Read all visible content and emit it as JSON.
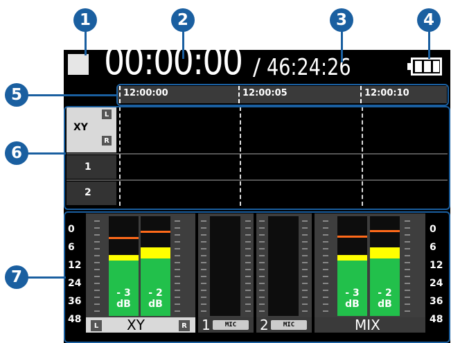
{
  "callouts": [
    "1",
    "2",
    "3",
    "4",
    "5",
    "6",
    "7"
  ],
  "header": {
    "elapsed_time": "00:00:00",
    "separator": "/",
    "remaining_time": "46:24:26",
    "status_icon": "stop-square-icon",
    "battery_icon": "battery-icon"
  },
  "timeline": {
    "marks": [
      "12:00:00",
      "12:00:05",
      "12:00:10"
    ]
  },
  "tracks": [
    {
      "label": "XY",
      "channels": [
        "L",
        "R"
      ]
    },
    {
      "label": "1"
    },
    {
      "label": "2"
    }
  ],
  "meters": {
    "scale_left": [
      "0",
      "6",
      "12",
      "24",
      "36",
      "48"
    ],
    "scale_right": [
      "0",
      "6",
      "12",
      "24",
      "36",
      "48"
    ],
    "xy": {
      "label": "XY",
      "left_tag": "L",
      "right_tag": "R",
      "left_db_value": "- 3",
      "right_db_value": "- 2",
      "db_unit": "dB"
    },
    "input1": {
      "number": "1",
      "tag": "MIC"
    },
    "input2": {
      "number": "2",
      "tag": "MIC"
    },
    "mix": {
      "label": "MIX",
      "left_db_value": "- 3",
      "right_db_value": "- 2",
      "db_unit": "dB"
    }
  },
  "colors": {
    "callout": "#1a5fa0",
    "meter_fill": "#22c04b",
    "meter_hot": "#ffff00",
    "peak_hold": "#ff6a1a"
  }
}
